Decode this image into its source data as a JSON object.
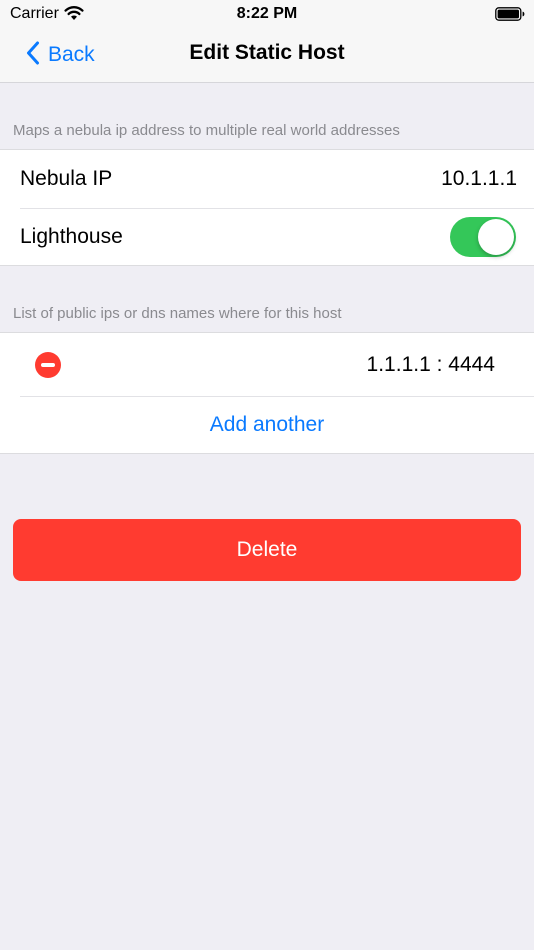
{
  "status_bar": {
    "carrier": "Carrier",
    "time": "8:22 PM",
    "wifi_icon": "wifi-icon",
    "battery_icon": "battery-icon"
  },
  "nav": {
    "back_label": "Back",
    "back_icon": "chevron-left-icon",
    "title": "Edit Static Host"
  },
  "host_section": {
    "caption": "Maps a nebula ip address to multiple real world addresses",
    "nebula_ip_label": "Nebula IP",
    "nebula_ip_value": "10.1.1.1",
    "lighthouse_label": "Lighthouse",
    "lighthouse_enabled": true
  },
  "addresses_section": {
    "caption": "List of public ips or dns names where for this host",
    "addresses": [
      {
        "value": "1.1.1.1 : 4444"
      }
    ],
    "add_label": "Add another"
  },
  "delete_label": "Delete",
  "colors": {
    "accent": "#0a7aff",
    "toggle_on": "#34c759",
    "destructive": "#ff3b30",
    "background": "#efeef4"
  }
}
